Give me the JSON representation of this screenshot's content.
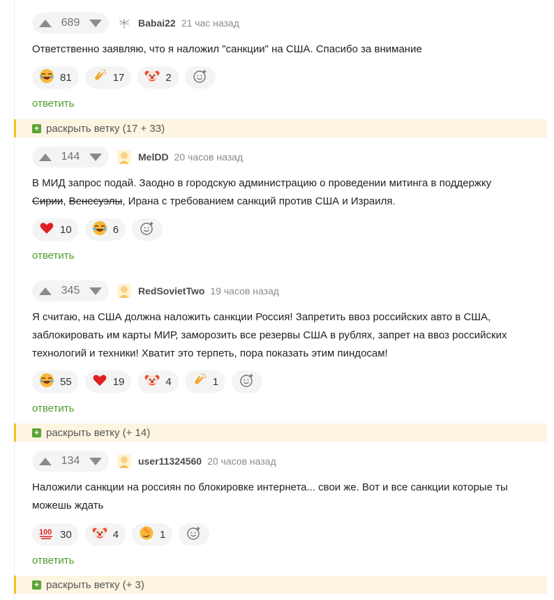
{
  "comments": [
    {
      "score": "689",
      "author": "Babai22",
      "time": "21 час назад",
      "avatar_icon": "cannabis-leaf-icon",
      "text": "Ответственно заявляю, что я наложил \"санкции\" на США. Спасибо за внимание",
      "reactions": [
        {
          "icon": "laughing-emoji-icon",
          "count": "81"
        },
        {
          "icon": "clapping-hands-icon",
          "count": "17"
        },
        {
          "icon": "clown-emoji-icon",
          "count": "2"
        }
      ],
      "reply_label": "ответить"
    },
    {
      "score": "144",
      "author": "MelDD",
      "time": "20 часов назад",
      "avatar_icon": "default-avatar-icon",
      "text_line1": "В МИД запрос подай. Заодно в городскую администрацию о проведении митинга в поддержку",
      "text_strike1": "Сирии",
      "text_sep": ", ",
      "text_strike2": "Венесуэлы",
      "text_rest": ", Ирана с требованием санкций против США и Израиля.",
      "reactions": [
        {
          "icon": "heart-icon",
          "count": "10"
        },
        {
          "icon": "laughing-emoji-icon",
          "count": "6"
        }
      ],
      "reply_label": "ответить"
    },
    {
      "score": "345",
      "author": "RedSovietTwo",
      "time": "19 часов назад",
      "avatar_icon": "default-avatar-icon",
      "text": "Я считаю, на США должна наложить санкции Россия! Запретить ввоз российских авто в США,\nзаблокировать им карты МИР, заморозить все резервы США в рублях, запрет на ввоз российских\nтехнологий и техники! Хватит это терпеть, пора показать этим пиндосам!",
      "reactions": [
        {
          "icon": "laughing-emoji-icon",
          "count": "55"
        },
        {
          "icon": "heart-icon",
          "count": "19"
        },
        {
          "icon": "clown-emoji-icon",
          "count": "4"
        },
        {
          "icon": "clapping-hands-icon",
          "count": "1"
        }
      ],
      "reply_label": "ответить"
    },
    {
      "score": "134",
      "author": "user11324560",
      "time": "20 часов назад",
      "avatar_icon": "default-avatar-icon",
      "text": "Наложили санкции на россиян по блокировке интернета... свои же. Вот и все санкции которые ты\nможешь ждать",
      "reactions": [
        {
          "icon": "hundred-points-icon",
          "count": "30"
        },
        {
          "icon": "clown-emoji-icon",
          "count": "4"
        },
        {
          "icon": "facepalm-emoji-icon",
          "count": "1"
        }
      ],
      "reply_label": "ответить"
    }
  ],
  "branches": [
    {
      "label": "раскрыть ветку (17 + 33)"
    },
    {
      "label": "раскрыть ветку (+ 14)"
    },
    {
      "label": "раскрыть ветку (+ 3)"
    }
  ],
  "icons": {
    "vote_up": "arrow-up-icon",
    "vote_down": "arrow-down-icon",
    "add_reaction": "add-reaction-icon",
    "expand": "plus-icon"
  },
  "colors": {
    "reply_green": "#4e9a2b",
    "branch_bg": "#fdf5e1",
    "branch_accent": "#f3c11b",
    "plus_green": "#5aa434"
  }
}
